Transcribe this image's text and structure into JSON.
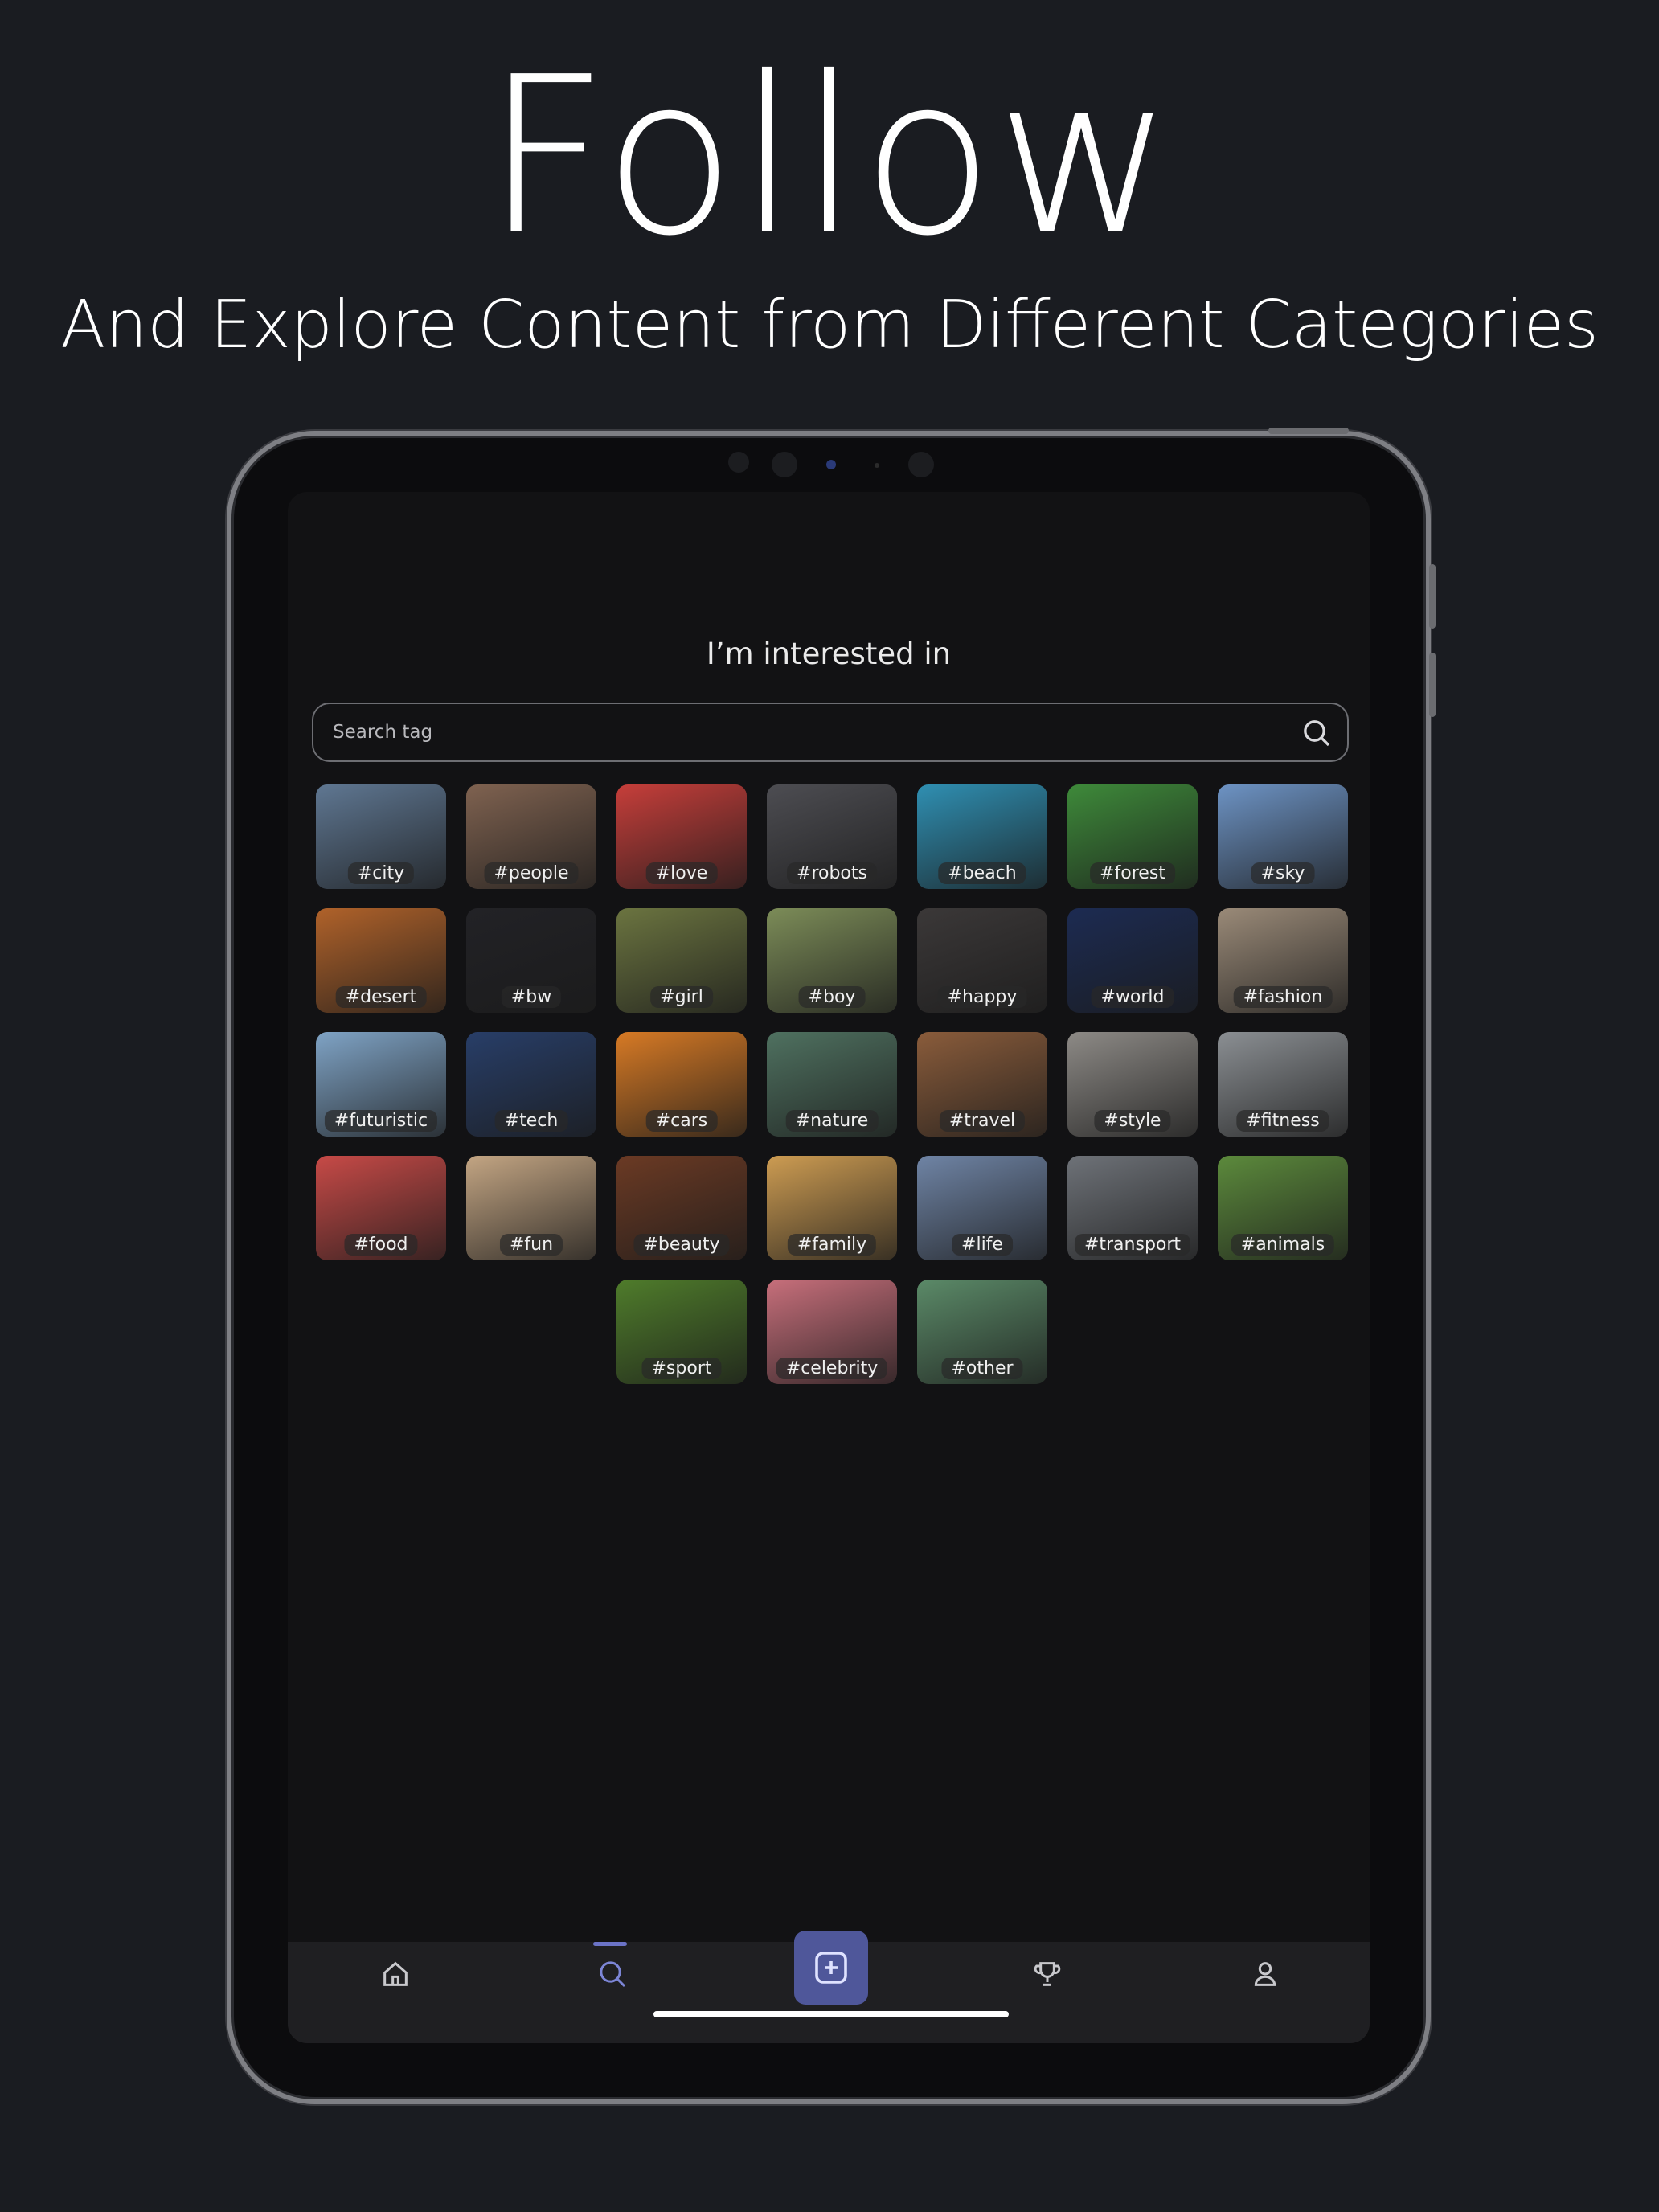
{
  "promo": {
    "headline": "Follow",
    "subheadline": "And Explore Content from Different Categories"
  },
  "screen": {
    "title": "I’m interested in",
    "search": {
      "placeholder": "Search tag",
      "icon": "search-icon"
    }
  },
  "tags": [
    {
      "label": "#city",
      "color": "#5f7792"
    },
    {
      "label": "#people",
      "color": "#7f6250"
    },
    {
      "label": "#love",
      "color": "#c63e3a"
    },
    {
      "label": "#robots",
      "color": "#4d4d52"
    },
    {
      "label": "#beach",
      "color": "#2f8fb2"
    },
    {
      "label": "#forest",
      "color": "#3e8a3a"
    },
    {
      "label": "#sky",
      "color": "#6d93c4"
    },
    {
      "label": "#desert",
      "color": "#b0622a"
    },
    {
      "label": "#bw",
      "color": "#222226"
    },
    {
      "label": "#girl",
      "color": "#6b7440"
    },
    {
      "label": "#boy",
      "color": "#7c8c58"
    },
    {
      "label": "#happy",
      "color": "#3b3838"
    },
    {
      "label": "#world",
      "color": "#1c2b52"
    },
    {
      "label": "#fashion",
      "color": "#9a8a78"
    },
    {
      "label": "#futuristic",
      "color": "#7fa3c5"
    },
    {
      "label": "#tech",
      "color": "#283e68"
    },
    {
      "label": "#cars",
      "color": "#d77a25"
    },
    {
      "label": "#nature",
      "color": "#4f7160"
    },
    {
      "label": "#travel",
      "color": "#8a5c3b"
    },
    {
      "label": "#style",
      "color": "#8d8a86"
    },
    {
      "label": "#fitness",
      "color": "#8b8f93"
    },
    {
      "label": "#food",
      "color": "#c74a47"
    },
    {
      "label": "#fun",
      "color": "#c3a583"
    },
    {
      "label": "#beauty",
      "color": "#6b3a24"
    },
    {
      "label": "#family",
      "color": "#cd9c52"
    },
    {
      "label": "#life",
      "color": "#6f84a5"
    },
    {
      "label": "#transport",
      "color": "#6e7278"
    },
    {
      "label": "#animals",
      "color": "#5c8a3c"
    },
    {
      "label": "#sport",
      "color": "#4f7c2b"
    },
    {
      "label": "#celebrity",
      "color": "#c76f7b"
    },
    {
      "label": "#other",
      "color": "#5b8a68"
    }
  ],
  "nav": {
    "items": [
      {
        "name": "home",
        "icon": "home-icon"
      },
      {
        "name": "search",
        "icon": "search-icon",
        "active": true
      },
      {
        "name": "add",
        "icon": "plus-square-icon"
      },
      {
        "name": "achievements",
        "icon": "trophy-icon"
      },
      {
        "name": "profile",
        "icon": "user-icon"
      }
    ],
    "accent": "#6b73c7"
  }
}
